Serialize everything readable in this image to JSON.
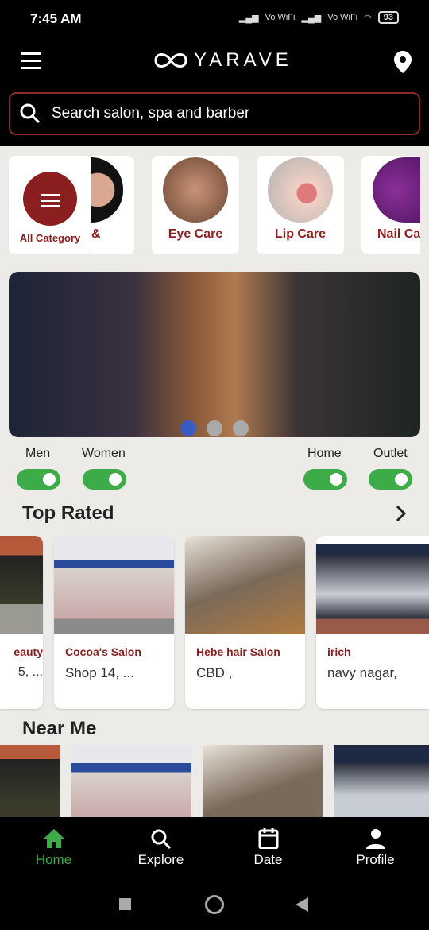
{
  "status_bar": {
    "time": "7:45 AM",
    "battery": "93",
    "net1": "Vo WiFi",
    "net2": "Vo WiFi"
  },
  "header": {
    "logo": "YARAVE"
  },
  "search": {
    "placeholder": "Search salon, spa and barber"
  },
  "categories": [
    {
      "label": "All Category"
    },
    {
      "label": "&"
    },
    {
      "label": "Eye Care"
    },
    {
      "label": "Lip Care"
    },
    {
      "label": "Nail Ca"
    }
  ],
  "banner": {
    "active_dot": 0,
    "dots": 3
  },
  "filters": [
    {
      "label": "Men",
      "on": true
    },
    {
      "label": "Women",
      "on": true
    },
    {
      "label": "Home",
      "on": true
    },
    {
      "label": "Outlet",
      "on": true
    }
  ],
  "top_rated": {
    "title": "Top Rated",
    "items": [
      {
        "name": "eauty",
        "address": "5, ..."
      },
      {
        "name": "Cocoa's Salon",
        "address": "Shop 14, ..."
      },
      {
        "name": "Hebe hair Salon",
        "address": "CBD ,"
      },
      {
        "name": "irich",
        "address": "navy nagar,"
      }
    ]
  },
  "near_me": {
    "title": "Near Me"
  },
  "bottom_nav": [
    {
      "label": "Home",
      "active": true
    },
    {
      "label": "Explore"
    },
    {
      "label": "Date"
    },
    {
      "label": "Profile"
    }
  ],
  "colors": {
    "accent": "#8b1e1e",
    "toggle": "#3cab48",
    "nav_active": "#3cab48"
  }
}
